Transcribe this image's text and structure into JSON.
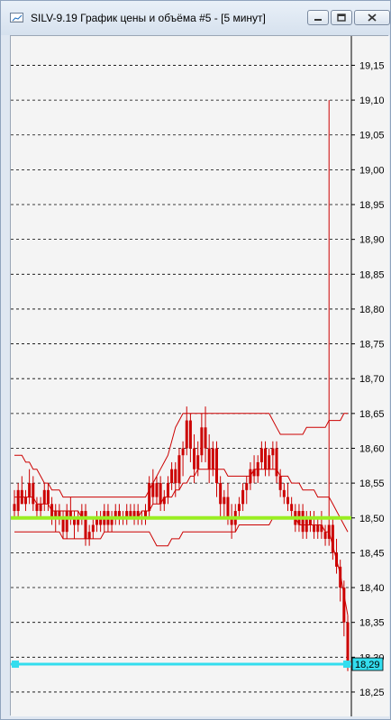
{
  "window": {
    "title": "SILV-9.19 График цены и объёма #5 - [5 минут]",
    "icon": "chart-window-icon",
    "controls": [
      "minimize-icon",
      "restore-icon",
      "close-icon"
    ]
  },
  "chart_data": {
    "type": "line",
    "title": "",
    "xlabel": "",
    "ylabel": "",
    "ylim": [
      18.215,
      19.192
    ],
    "y_ticks": [
      "19,15",
      "19,10",
      "19,05",
      "19,00",
      "18,95",
      "18,90",
      "18,85",
      "18,80",
      "18,75",
      "18,70",
      "18,65",
      "18,60",
      "18,55",
      "18,50",
      "18,45",
      "18,40",
      "18,35",
      "18,30",
      "18,25"
    ],
    "tick_values": [
      19.15,
      19.1,
      19.05,
      19.0,
      18.95,
      18.9,
      18.85,
      18.8,
      18.75,
      18.7,
      18.65,
      18.6,
      18.55,
      18.5,
      18.45,
      18.4,
      18.35,
      18.3,
      18.25
    ],
    "grid": true,
    "current_price_label": "18,29",
    "current_price": 18.29,
    "level_line_value": 18.5,
    "colors": {
      "candles": "#cc0000",
      "bands": "#cc0000",
      "level_line": "#99ee22",
      "price_line": "#33ddee",
      "grid": "#000000",
      "background": "#f4f4f4"
    },
    "candles": [
      [
        18.52,
        18.54,
        18.5,
        18.51
      ],
      [
        18.51,
        18.55,
        18.5,
        18.54
      ],
      [
        18.54,
        18.56,
        18.52,
        18.52
      ],
      [
        18.52,
        18.54,
        18.51,
        18.53
      ],
      [
        18.53,
        18.57,
        18.52,
        18.55
      ],
      [
        18.55,
        18.56,
        18.51,
        18.52
      ],
      [
        18.52,
        18.53,
        18.5,
        18.51
      ],
      [
        18.51,
        18.53,
        18.5,
        18.52
      ],
      [
        18.52,
        18.55,
        18.51,
        18.54
      ],
      [
        18.54,
        18.55,
        18.51,
        18.52
      ],
      [
        18.52,
        18.53,
        18.49,
        18.5
      ],
      [
        18.5,
        18.52,
        18.48,
        18.51
      ],
      [
        18.51,
        18.52,
        18.49,
        18.5
      ],
      [
        18.5,
        18.51,
        18.47,
        18.48
      ],
      [
        18.48,
        18.52,
        18.47,
        18.51
      ],
      [
        18.51,
        18.53,
        18.49,
        18.5
      ],
      [
        18.5,
        18.51,
        18.47,
        18.49
      ],
      [
        18.49,
        18.51,
        18.48,
        18.5
      ],
      [
        18.5,
        18.52,
        18.49,
        18.51
      ],
      [
        18.51,
        18.52,
        18.46,
        18.47
      ],
      [
        18.47,
        18.49,
        18.46,
        18.48
      ],
      [
        18.48,
        18.5,
        18.47,
        18.49
      ],
      [
        18.49,
        18.51,
        18.48,
        18.5
      ],
      [
        18.5,
        18.51,
        18.48,
        18.49
      ],
      [
        18.49,
        18.52,
        18.48,
        18.51
      ],
      [
        18.51,
        18.52,
        18.48,
        18.49
      ],
      [
        18.49,
        18.51,
        18.48,
        18.5
      ],
      [
        18.5,
        18.52,
        18.49,
        18.51
      ],
      [
        18.51,
        18.52,
        18.49,
        18.5
      ],
      [
        18.5,
        18.51,
        18.49,
        18.5
      ],
      [
        18.5,
        18.52,
        18.49,
        18.51
      ],
      [
        18.51,
        18.52,
        18.5,
        18.5
      ],
      [
        18.5,
        18.52,
        18.49,
        18.51
      ],
      [
        18.51,
        18.52,
        18.49,
        18.5
      ],
      [
        18.5,
        18.51,
        18.49,
        18.5
      ],
      [
        18.5,
        18.52,
        18.49,
        18.51
      ],
      [
        18.51,
        18.56,
        18.5,
        18.55
      ],
      [
        18.55,
        18.57,
        18.52,
        18.53
      ],
      [
        18.53,
        18.56,
        18.52,
        18.55
      ],
      [
        18.55,
        18.56,
        18.51,
        18.52
      ],
      [
        18.52,
        18.54,
        18.51,
        18.53
      ],
      [
        18.53,
        18.56,
        18.52,
        18.55
      ],
      [
        18.55,
        18.58,
        18.54,
        18.57
      ],
      [
        18.57,
        18.58,
        18.53,
        18.55
      ],
      [
        18.55,
        18.6,
        18.54,
        18.59
      ],
      [
        18.59,
        18.61,
        18.56,
        18.6
      ],
      [
        18.6,
        18.66,
        18.59,
        18.64
      ],
      [
        18.64,
        18.65,
        18.58,
        18.6
      ],
      [
        18.6,
        18.62,
        18.55,
        18.57
      ],
      [
        18.57,
        18.61,
        18.56,
        18.59
      ],
      [
        18.59,
        18.65,
        18.58,
        18.63
      ],
      [
        18.63,
        18.66,
        18.58,
        18.6
      ],
      [
        18.6,
        18.62,
        18.55,
        18.57
      ],
      [
        18.57,
        18.61,
        18.56,
        18.6
      ],
      [
        18.6,
        18.61,
        18.53,
        18.55
      ],
      [
        18.55,
        18.56,
        18.5,
        18.52
      ],
      [
        18.52,
        18.54,
        18.5,
        18.53
      ],
      [
        18.53,
        18.55,
        18.49,
        18.5
      ],
      [
        18.5,
        18.52,
        18.47,
        18.49
      ],
      [
        18.49,
        18.52,
        18.48,
        18.51
      ],
      [
        18.51,
        18.53,
        18.5,
        18.52
      ],
      [
        18.52,
        18.55,
        18.51,
        18.54
      ],
      [
        18.54,
        18.56,
        18.52,
        18.55
      ],
      [
        18.55,
        18.58,
        18.54,
        18.57
      ],
      [
        18.57,
        18.59,
        18.55,
        18.56
      ],
      [
        18.56,
        18.59,
        18.55,
        18.58
      ],
      [
        18.58,
        18.61,
        18.57,
        18.6
      ],
      [
        18.6,
        18.61,
        18.56,
        18.57
      ],
      [
        18.57,
        18.6,
        18.56,
        18.59
      ],
      [
        18.59,
        18.61,
        18.57,
        18.6
      ],
      [
        18.6,
        18.61,
        18.55,
        18.56
      ],
      [
        18.56,
        18.57,
        18.53,
        18.54
      ],
      [
        18.54,
        18.55,
        18.52,
        18.53
      ],
      [
        18.53,
        18.55,
        18.51,
        18.52
      ],
      [
        18.52,
        18.53,
        18.5,
        18.51
      ],
      [
        18.51,
        18.52,
        18.48,
        18.49
      ],
      [
        18.49,
        18.52,
        18.48,
        18.51
      ],
      [
        18.51,
        18.52,
        18.47,
        18.48
      ],
      [
        18.48,
        18.51,
        18.47,
        18.5
      ],
      [
        18.5,
        18.51,
        18.48,
        18.49
      ],
      [
        18.49,
        18.51,
        18.47,
        18.48
      ],
      [
        18.48,
        18.5,
        18.47,
        18.49
      ],
      [
        18.49,
        18.51,
        18.47,
        18.48
      ],
      [
        18.48,
        18.49,
        18.46,
        18.47
      ],
      [
        18.47,
        19.1,
        18.46,
        18.49
      ],
      [
        18.49,
        18.5,
        18.44,
        18.45
      ],
      [
        18.45,
        18.47,
        18.42,
        18.43
      ],
      [
        18.43,
        18.44,
        18.38,
        18.4
      ],
      [
        18.4,
        18.41,
        18.33,
        18.35
      ],
      [
        18.35,
        18.36,
        18.28,
        18.29
      ]
    ],
    "bands": {
      "upper": [
        18.59,
        18.59,
        18.59,
        18.58,
        18.58,
        18.57,
        18.57,
        18.56,
        18.55,
        18.55,
        18.54,
        18.54,
        18.54,
        18.53,
        18.53,
        18.53,
        18.53,
        18.53,
        18.53,
        18.53,
        18.53,
        18.53,
        18.53,
        18.53,
        18.53,
        18.53,
        18.53,
        18.53,
        18.53,
        18.53,
        18.53,
        18.53,
        18.53,
        18.53,
        18.53,
        18.53,
        18.54,
        18.55,
        18.56,
        18.57,
        18.58,
        18.59,
        18.61,
        18.63,
        18.64,
        18.65,
        18.65,
        18.65,
        18.65,
        18.65,
        18.65,
        18.65,
        18.65,
        18.65,
        18.65,
        18.65,
        18.65,
        18.65,
        18.65,
        18.65,
        18.65,
        18.65,
        18.65,
        18.65,
        18.65,
        18.65,
        18.65,
        18.65,
        18.65,
        18.64,
        18.63,
        18.62,
        18.62,
        18.62,
        18.62,
        18.62,
        18.62,
        18.62,
        18.63,
        18.63,
        18.63,
        18.63,
        18.63,
        18.63,
        18.64,
        18.64,
        18.64,
        18.64,
        18.65,
        18.65
      ],
      "middle": [
        18.53,
        18.53,
        18.53,
        18.53,
        18.53,
        18.53,
        18.52,
        18.52,
        18.52,
        18.52,
        18.51,
        18.51,
        18.51,
        18.51,
        18.51,
        18.51,
        18.51,
        18.51,
        18.5,
        18.5,
        18.5,
        18.5,
        18.5,
        18.5,
        18.5,
        18.5,
        18.5,
        18.5,
        18.5,
        18.5,
        18.5,
        18.5,
        18.5,
        18.5,
        18.51,
        18.51,
        18.51,
        18.52,
        18.52,
        18.52,
        18.53,
        18.53,
        18.53,
        18.54,
        18.54,
        18.55,
        18.55,
        18.56,
        18.56,
        18.57,
        18.57,
        18.57,
        18.57,
        18.57,
        18.57,
        18.57,
        18.57,
        18.56,
        18.56,
        18.56,
        18.56,
        18.56,
        18.56,
        18.56,
        18.57,
        18.57,
        18.57,
        18.57,
        18.57,
        18.57,
        18.57,
        18.56,
        18.56,
        18.56,
        18.55,
        18.55,
        18.55,
        18.54,
        18.54,
        18.54,
        18.54,
        18.53,
        18.53,
        18.53,
        18.53,
        18.52,
        18.51,
        18.5,
        18.49,
        18.48
      ],
      "lower": [
        18.48,
        18.48,
        18.48,
        18.48,
        18.48,
        18.48,
        18.48,
        18.48,
        18.48,
        18.48,
        18.48,
        18.48,
        18.48,
        18.47,
        18.47,
        18.47,
        18.47,
        18.47,
        18.47,
        18.47,
        18.47,
        18.47,
        18.47,
        18.47,
        18.48,
        18.48,
        18.48,
        18.48,
        18.48,
        18.48,
        18.48,
        18.48,
        18.48,
        18.48,
        18.48,
        18.48,
        18.48,
        18.47,
        18.46,
        18.46,
        18.46,
        18.46,
        18.47,
        18.47,
        18.47,
        18.48,
        18.48,
        18.48,
        18.48,
        18.48,
        18.48,
        18.48,
        18.48,
        18.48,
        18.48,
        18.48,
        18.48,
        18.48,
        18.48,
        18.48,
        18.49,
        18.49,
        18.49,
        18.49,
        18.49,
        18.49,
        18.49,
        18.49,
        18.49,
        18.5,
        18.5,
        18.5,
        18.5,
        18.5,
        18.5,
        18.5,
        18.49,
        18.49,
        18.49,
        18.49,
        18.49,
        18.49,
        18.49,
        18.48,
        18.48,
        18.46,
        18.44,
        18.42,
        18.39,
        18.36
      ]
    }
  }
}
